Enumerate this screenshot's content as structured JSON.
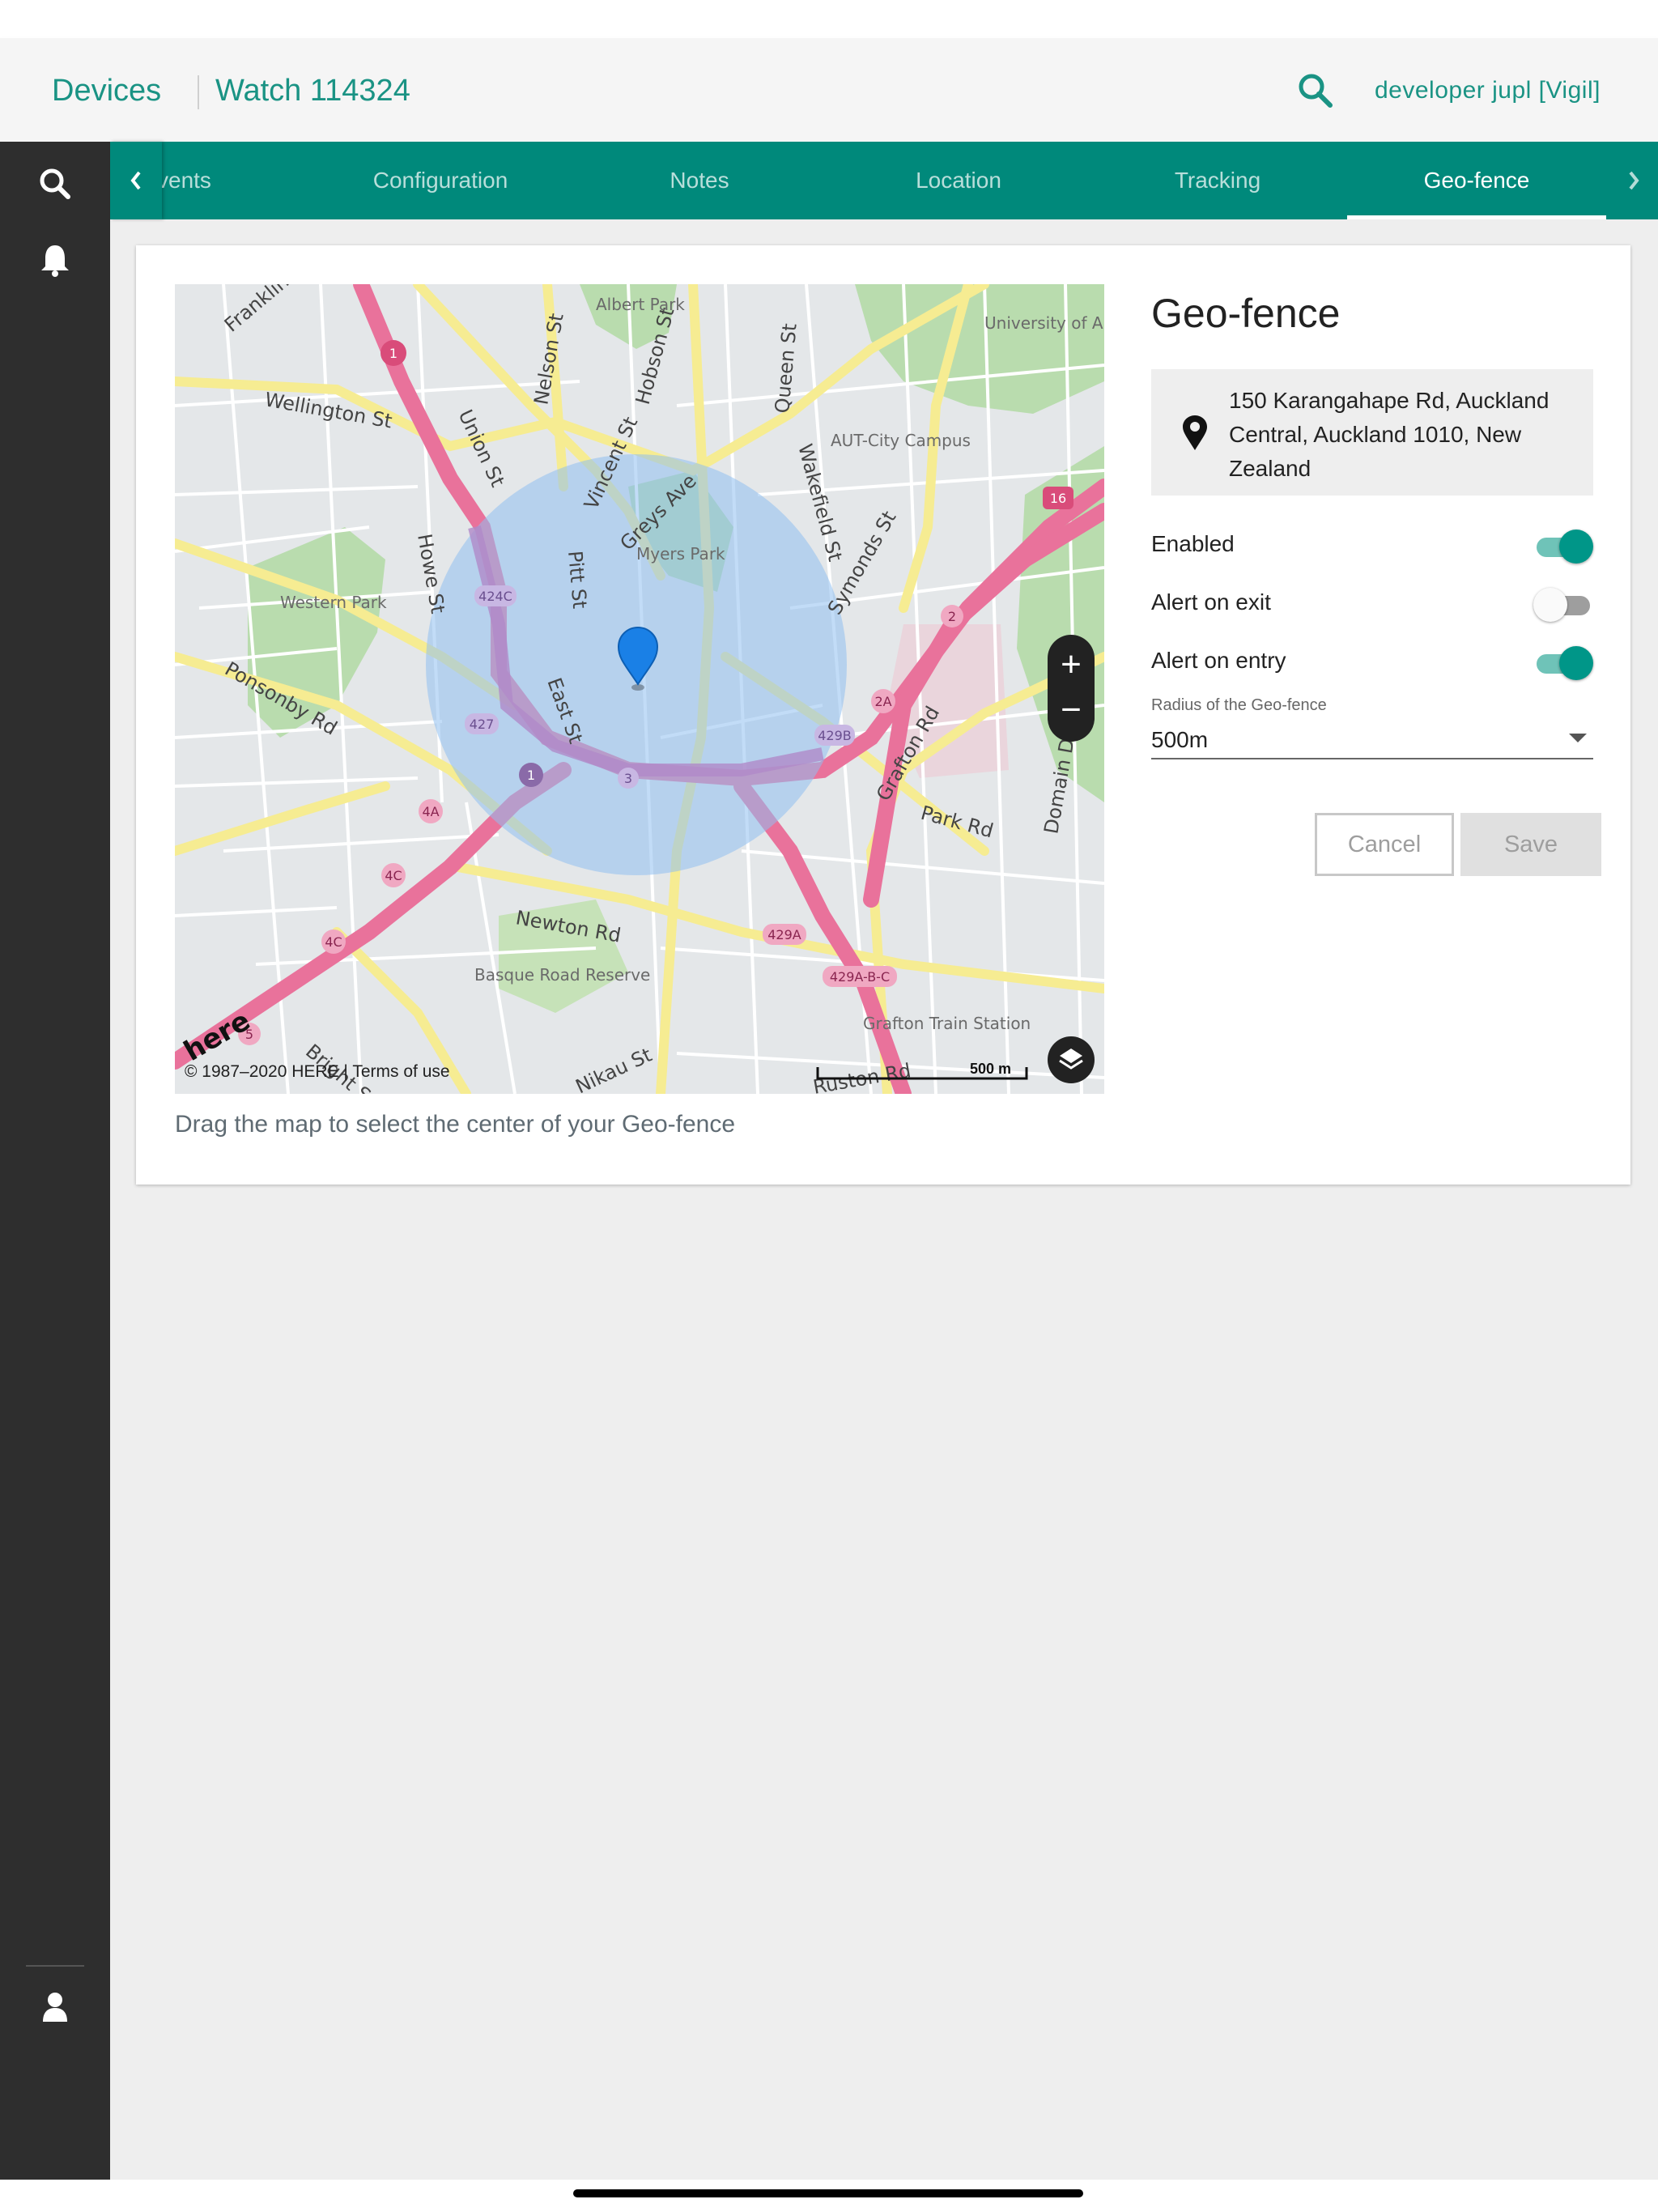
{
  "header": {
    "breadcrumb_root": "Devices",
    "breadcrumb_device": "Watch 114324",
    "user": "developer jupl [Vigil]",
    "search_icon": "search-icon"
  },
  "sidebar": {
    "items": [
      {
        "icon": "search-icon"
      },
      {
        "icon": "bell-icon"
      },
      {
        "icon": "user-icon"
      }
    ]
  },
  "tabs": [
    {
      "label": "vents",
      "active": false
    },
    {
      "label": "Configuration",
      "active": false
    },
    {
      "label": "Notes",
      "active": false
    },
    {
      "label": "Location",
      "active": false
    },
    {
      "label": "Tracking",
      "active": false
    },
    {
      "label": "Geo-fence",
      "active": true
    }
  ],
  "map": {
    "caption": "Drag the map to select the center of your Geo-fence",
    "copyright": "© 1987–2020 HERE | Terms of use",
    "scale": "500 m",
    "brand": "here",
    "zoom_in": "+",
    "zoom_out": "−",
    "streets": [
      "Franklin",
      "Wellington St",
      "Union St",
      "Nelson St",
      "Hobson St",
      "Queen St",
      "Wakefield St",
      "Symonds St",
      "Vincent St",
      "Greys Ave",
      "Pitt St",
      "Howe St",
      "East St",
      "Ponsonby Rd",
      "Newton Rd",
      "Grafton Rd",
      "Park Rd",
      "Domain Dr",
      "Nikau St",
      "Bright St",
      "Ruston Rd"
    ],
    "places": [
      "Albert Park",
      "University of Auckland-City Campus",
      "AUT-City Campus",
      "Myers Park",
      "Western Park",
      "Basque Road Reserve",
      "Grafton Train Station"
    ],
    "route_shields": [
      "1",
      "16",
      "2",
      "2A",
      "424C",
      "427",
      "1",
      "3",
      "429B",
      "4A",
      "4C",
      "4C",
      "429A",
      "429A-B-C",
      "5"
    ]
  },
  "geofence": {
    "title": "Geo-fence",
    "address": "150 Karangahape Rd, Auckland Central, Auckland 1010, New Zealand",
    "options": [
      {
        "label": "Enabled",
        "on": true
      },
      {
        "label": "Alert on exit",
        "on": false
      },
      {
        "label": "Alert on entry",
        "on": true
      }
    ],
    "radius_label": "Radius of the Geo-fence",
    "radius_value": "500m",
    "cancel_label": "Cancel",
    "save_label": "Save"
  },
  "colors": {
    "accent": "#00897b",
    "link": "#1a9384",
    "sidebar": "#2e2e2e",
    "fence": "#8fbff0"
  }
}
